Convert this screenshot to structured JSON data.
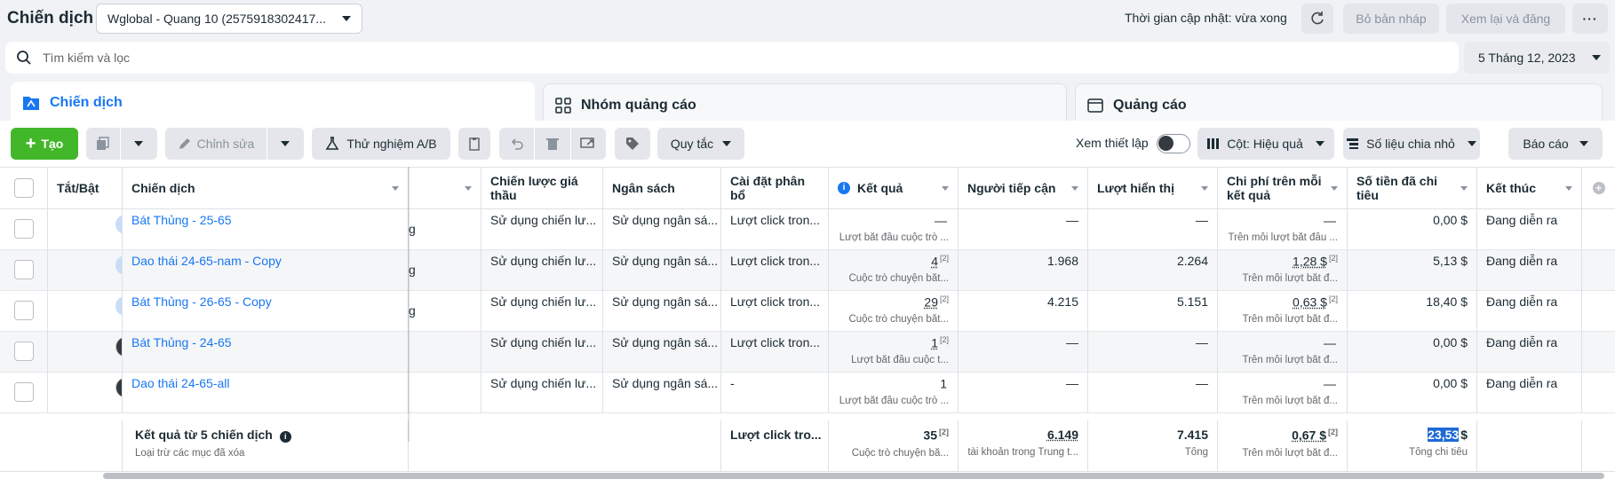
{
  "header": {
    "title": "Chiến dịch",
    "account": "Wglobal - Quang 10 (2575918302417...",
    "update_time": "Thời gian cập nhật: vừa xong",
    "discard": "Bỏ bản nháp",
    "review_publish": "Xem lại và đăng"
  },
  "search": {
    "placeholder": "Tìm kiếm và lọc"
  },
  "date_range": "5 Tháng 12, 2023",
  "tabs": [
    {
      "label": "Chiến dịch"
    },
    {
      "label": "Nhóm quảng cáo"
    },
    {
      "label": "Quảng cáo"
    }
  ],
  "toolbar": {
    "create": "Tạo",
    "edit": "Chỉnh sửa",
    "ab_test": "Thử nghiệm A/B",
    "rules": "Quy tắc",
    "view_setup": "Xem thiết lập",
    "columns": "Cột: Hiệu quả",
    "breakdown": "Số liệu chia nhỏ",
    "reports": "Báo cáo"
  },
  "columns": {
    "toggle": "Tắt/Bật",
    "campaign": "Chiến dịch",
    "bid_strategy": "Chiến lược giá thầu",
    "budget": "Ngân sách",
    "attribution": "Cài đặt phân bổ",
    "results": "Kết quả",
    "reach": "Người tiếp cận",
    "impressions": "Lượt hiển thị",
    "cost_per_result": "Chi phí trên mỗi kết quả",
    "amount_spent": "Số tiền đã chi tiêu",
    "ends": "Kết thúc"
  },
  "rows": [
    {
      "on": true,
      "name": "Bát Thủng - 25-65",
      "partial": "g",
      "bid": "Sử dụng chiến lư...",
      "budget": "Sử dụng ngân sá...",
      "attr": "Lượt click tron...",
      "result": "—",
      "result_sup": "",
      "result_sub": "Lượt bắt đầu cuộc trò ...",
      "reach": "—",
      "impr": "—",
      "cpr": "—",
      "cpr_sup": "",
      "cpr_sub": "Trên mỗi lượt bắt đầu ...",
      "spent": "0,00 $",
      "ends": "Đang diễn ra"
    },
    {
      "on": true,
      "name": "Dao thái 24-65-nam - Copy",
      "partial": "g",
      "bid": "Sử dụng chiến lư...",
      "budget": "Sử dụng ngân sá...",
      "attr": "Lượt click tron...",
      "result": "4",
      "result_sup": "[2]",
      "result_sub": "Cuộc trò chuyện bắt...",
      "reach": "1.968",
      "impr": "2.264",
      "cpr": "1,28 $",
      "cpr_sup": "[2]",
      "cpr_sub": "Trên mỗi lượt bắt đ...",
      "spent": "5,13 $",
      "ends": "Đang diễn ra"
    },
    {
      "on": true,
      "name": "Bát Thủng - 26-65 - Copy",
      "partial": "g",
      "bid": "Sử dụng chiến lư...",
      "budget": "Sử dụng ngân sá...",
      "attr": "Lượt click tron...",
      "result": "29",
      "result_sup": "[2]",
      "result_sub": "Cuộc trò chuyện bắt...",
      "reach": "4.215",
      "impr": "5.151",
      "cpr": "0,63 $",
      "cpr_sup": "[2]",
      "cpr_sub": "Trên mỗi lượt bắt đ...",
      "spent": "18,40 $",
      "ends": "Đang diễn ra"
    },
    {
      "on": false,
      "name": "Bát Thủng - 24-65",
      "partial": "",
      "bid": "Sử dụng chiến lư...",
      "budget": "Sử dụng ngân sá...",
      "attr": "Lượt click tron...",
      "result": "1",
      "result_sup": "[2]",
      "result_sub": "Lượt bắt đầu cuộc t...",
      "reach": "—",
      "impr": "—",
      "cpr": "—",
      "cpr_sup": "",
      "cpr_sub": "Trên mỗi lượt bắt đ...",
      "spent": "0,00 $",
      "ends": "Đang diễn ra"
    },
    {
      "on": false,
      "name": "Dao thái 24-65-all",
      "partial": "",
      "bid": "Sử dụng chiến lư...",
      "budget": "Sử dụng ngân sá...",
      "attr": "-",
      "result": "1",
      "result_sup": "",
      "result_sub": "Lượt bắt đầu cuộc trò ...",
      "reach": "—",
      "impr": "—",
      "cpr": "—",
      "cpr_sup": "",
      "cpr_sub": "Trên mỗi lượt bắt đ...",
      "spent": "0,00 $",
      "ends": "Đang diễn ra"
    }
  ],
  "totals": {
    "label": "Kết quả từ 5 chiến dịch",
    "sub": "Loại trừ các mục đã xóa",
    "attr": "Lượt click tro...",
    "result": "35",
    "result_sup": "[2]",
    "result_sub": "Cuộc trò chuyện bắ...",
    "reach": "6.149",
    "reach_sub": "tài khoản trong Trung t...",
    "impr": "7.415",
    "impr_sub": "Tổng",
    "cpr": "0,67 $",
    "cpr_sup": "[2]",
    "cpr_sub": "Trên mỗi lượt bắt đ...",
    "spent_value": "23,53",
    "spent_currency": "$",
    "spent_sub": "Tổng chi tiêu"
  },
  "colors": {
    "accent": "#1877f2",
    "create": "#42b72a"
  }
}
